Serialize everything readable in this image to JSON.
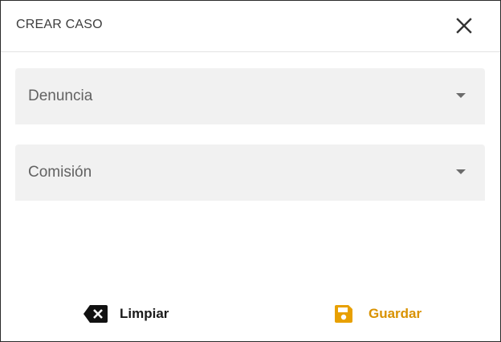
{
  "dialog": {
    "title": "CREAR CASO",
    "close_icon": "close-icon"
  },
  "fields": {
    "denuncia": {
      "label": "Denuncia",
      "icon": "chevron-down-icon"
    },
    "comision": {
      "label": "Comisión",
      "icon": "chevron-down-icon"
    }
  },
  "actions": {
    "clear": {
      "label": "Limpiar",
      "icon": "backspace-icon",
      "color": "#1a1a1a"
    },
    "save": {
      "label": "Guardar",
      "icon": "save-icon",
      "color": "#d99200"
    }
  }
}
